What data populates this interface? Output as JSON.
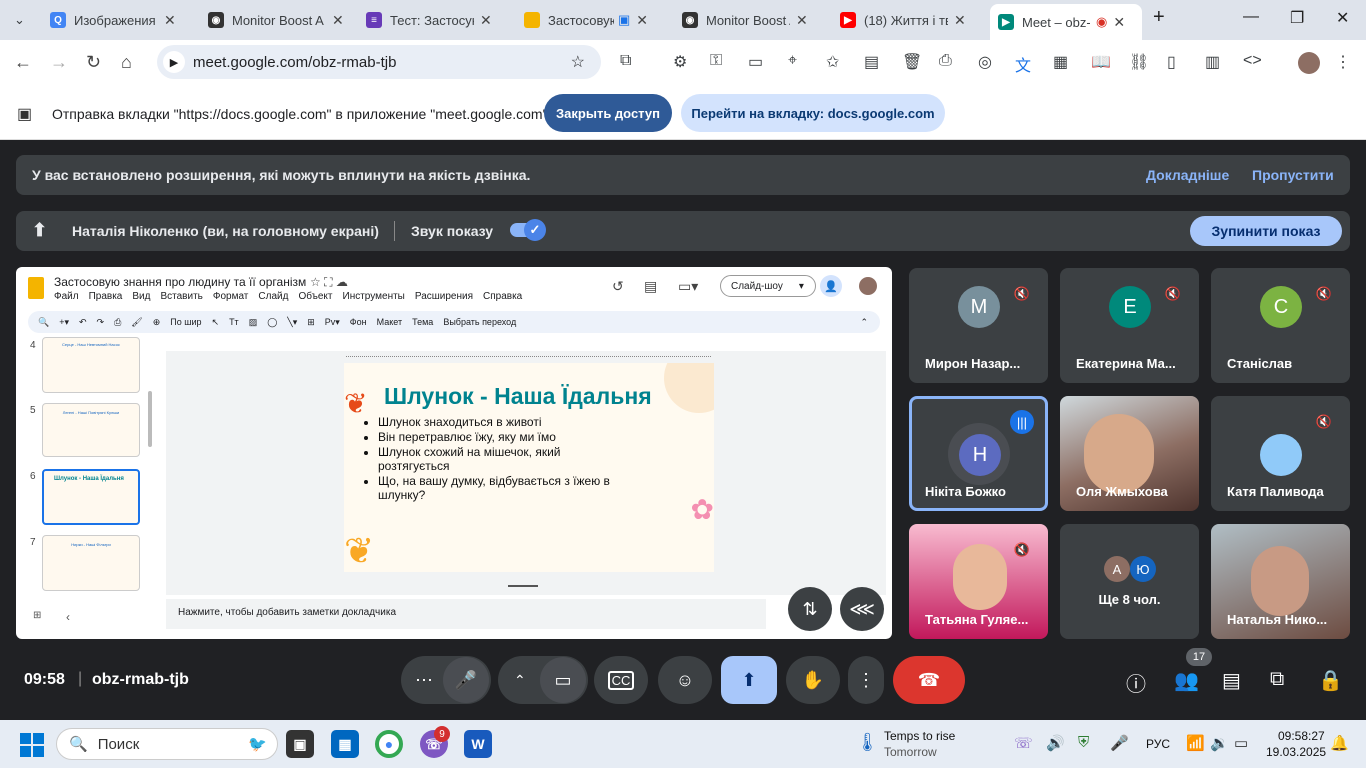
{
  "browser": {
    "tabs": [
      {
        "title": "Изображения В",
        "icon": "search-icon",
        "color": "#4285f4"
      },
      {
        "title": "Monitor Boost A",
        "icon": "app-icon",
        "color": "#333333"
      },
      {
        "title": "Тест: Застосую",
        "icon": "forms-icon",
        "color": "#673ab7"
      },
      {
        "title": "Застосовую",
        "icon": "slides-icon",
        "color": "#f4b400"
      },
      {
        "title": "Monitor Boost A",
        "icon": "app-icon",
        "color": "#333333"
      },
      {
        "title": "(18) Життя і твор",
        "icon": "youtube-icon",
        "color": "#ff0000"
      },
      {
        "title": "Meet – obz-",
        "icon": "meet-icon",
        "color": "#00897b"
      }
    ],
    "url": "meet.google.com/obz-rmab-tjb"
  },
  "sharebar": {
    "text": "Отправка вкладки \"https://docs.google.com\" в приложение \"meet.google.com\"...",
    "stop": "Закрыть доступ",
    "goto": "Перейти на вкладку: docs.google.com"
  },
  "meet": {
    "ext_warning": "У вас встановлено розширення, які можуть вплинути на якість дзвінка.",
    "learn_more": "Докладніше",
    "skip": "Пропустити",
    "presenter": "Наталія Ніколенко (ви, на головному екрані)",
    "sound": "Звук показу",
    "stop_share": "Зупинити показ",
    "time": "09:58",
    "code": "obz-rmab-tjb",
    "people_count": "17",
    "participants": [
      {
        "name": "Мирон Назар...",
        "initial": "М",
        "color": "#78909c"
      },
      {
        "name": "Екатерина Ма...",
        "initial": "Е",
        "color": "#00897b"
      },
      {
        "name": "Станіслав",
        "initial": "С",
        "color": "#7cb342"
      },
      {
        "name": "Нікіта Божко",
        "initial": "Н",
        "color": "#5c6bc0"
      },
      {
        "name": "Оля Жмыхова",
        "initial": "",
        "color": "#8d6e63"
      },
      {
        "name": "Катя Паливода",
        "initial": "",
        "color": "#3c4043"
      },
      {
        "name": "Татьяна Гуляе...",
        "initial": "",
        "color": "#c2185b"
      },
      {
        "name": "Ще 8 чол.",
        "initial": "",
        "color": "#3c4043"
      },
      {
        "name": "Наталья Нико...",
        "initial": "",
        "color": "#6d6d6d"
      }
    ],
    "more_avatars": [
      "А",
      "Ю"
    ]
  },
  "slides": {
    "doc_title": "Застосовую знання про людину та її організм",
    "menu": [
      "Файл",
      "Правка",
      "Вид",
      "Вставить",
      "Формат",
      "Слайд",
      "Объект",
      "Инструменты",
      "Расширения",
      "Справка"
    ],
    "slideshow": "Слайд-шоу",
    "toolbar": [
      "По шир",
      "Фон",
      "Макет",
      "Тема",
      "Выбрать переход"
    ],
    "thumbs": [
      {
        "num": "4",
        "title": "Серце - Наш Невтомний Насос"
      },
      {
        "num": "5",
        "title": "Легені - Наші Повітряні Кульки"
      },
      {
        "num": "6",
        "title": "Шлунок - Наша Їдальня"
      },
      {
        "num": "7",
        "title": "Нирки - Наші Фільтри"
      }
    ],
    "slide_title": "Шлунок - Наша Їдальня",
    "bullets": [
      "Шлунок знаходиться в животі",
      "Він перетравлює їжу, яку ми їмо",
      "Шлунок схожий на мішечок, який розтягується",
      "Що, на вашу думку, відбувається з їжею в шлунку?"
    ],
    "notes": "Нажмите, чтобы добавить заметки докладчика"
  },
  "taskbar": {
    "search": "Поиск",
    "weather_title": "Temps to rise",
    "weather_sub": "Tomorrow",
    "lang": "РУС",
    "clock_time": "09:58:27",
    "clock_date": "19.03.2025",
    "badge": "9"
  }
}
